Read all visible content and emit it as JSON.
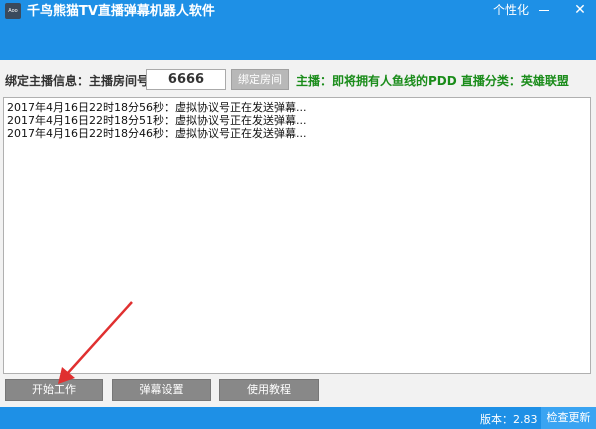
{
  "window": {
    "icon_text": "Aoo",
    "title": "千鸟熊猫TV直播弹幕机器人软件",
    "personalize": "个性化",
    "close_glyph": "✕"
  },
  "bind": {
    "label": "绑定主播信息：主播房间号",
    "room_value": "6666",
    "bind_button": "绑定房间",
    "anchor_info": "主播：即将拥有人鱼线的PDD  直播分类：英雄联盟"
  },
  "log": {
    "lines": [
      "2017年4月16日22时18分56秒：虚拟协议号正在发送弹幕...",
      "2017年4月16日22时18分51秒：虚拟协议号正在发送弹幕...",
      "2017年4月16日22时18分46秒：虚拟协议号正在发送弹幕..."
    ]
  },
  "actions": {
    "start": "开始工作",
    "danmu_settings": "弹幕设置",
    "tutorial": "使用教程"
  },
  "status": {
    "version": "版本：2.83",
    "update": "检查更新"
  },
  "colors": {
    "accent": "#1e90e6",
    "anchor_text": "#1a8c1a",
    "annotation_arrow": "#e03030"
  }
}
